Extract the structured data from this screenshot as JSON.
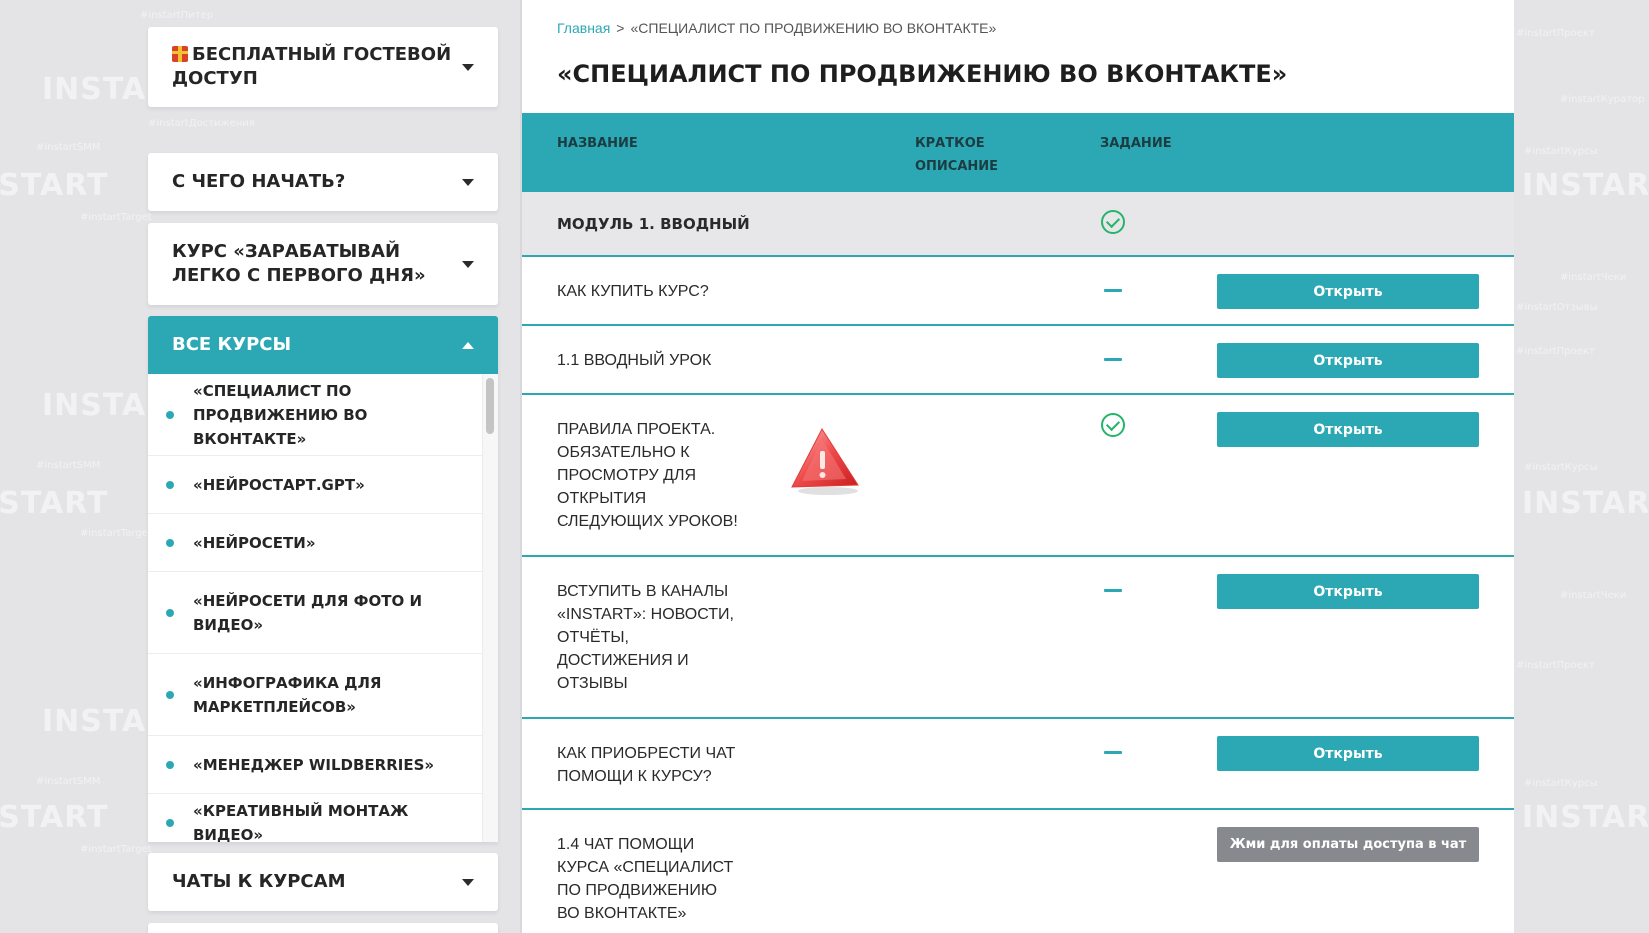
{
  "sidebar": {
    "guest_access": "БЕСПЛАТНЫЙ ГОСТЕВОЙ ДОСТУП",
    "where_to_start": "С ЧЕГО НАЧАТЬ?",
    "easy_course": "КУРС «ЗАРАБАТЫВАЙ ЛЕГКО С ПЕРВОГО ДНЯ»",
    "all_courses": "ВСЕ КУРСЫ",
    "course_chats": "ЧАТЫ К КУРСАМ",
    "courses": [
      "«СПЕЦИАЛИСТ ПО ПРОДВИЖЕНИЮ ВО ВКОНТАКТЕ»",
      "«НЕЙРОСТАРТ.GPT»",
      "«НЕЙРОСЕТИ»",
      "«НЕЙРОСЕТИ ДЛЯ ФОТО И ВИДЕО»",
      "«ИНФОГРАФИКА ДЛЯ МАРКЕТПЛЕЙСОВ»",
      "«МЕНЕДЖЕР WILDBERRIES»",
      "«КРЕАТИВНЫЙ МОНТАЖ ВИДЕО»"
    ]
  },
  "breadcrumb": {
    "home": "Главная",
    "separator": ">",
    "current": "«СПЕЦИАЛИСТ ПО ПРОДВИЖЕНИЮ ВО ВКОНТАКТЕ»"
  },
  "page_title": "«СПЕЦИАЛИСТ ПО ПРОДВИЖЕНИЮ ВО ВКОНТАКТЕ»",
  "table": {
    "headers": {
      "name": "НАЗВАНИЕ",
      "short_desc_1": "КРАТКОЕ",
      "short_desc_2": "ОПИСАНИЕ",
      "task": "ЗАДАНИЕ"
    },
    "module_1": "МОДУЛЬ 1. ВВОДНЫЙ",
    "rows": [
      {
        "title": "КАК КУПИТЬ КУРС?",
        "task": "dash",
        "button": "Открыть"
      },
      {
        "title": "1.1 ВВОДНЫЙ УРОК",
        "task": "dash",
        "button": "Открыть"
      },
      {
        "title_lines": [
          "ПРАВИЛА ПРОЕКТА.",
          "ОБЯЗАТЕЛЬНО К",
          "ПРОСМОТРУ ДЛЯ",
          "ОТКРЫТИЯ",
          "СЛЕДУЮЩИХ УРОКОВ!"
        ],
        "task": "check",
        "icon": "warning-icon",
        "button": "Открыть"
      },
      {
        "title_lines": [
          "ВСТУПИТЬ В КАНАЛЫ",
          "«INSTART»: НОВОСТИ,",
          "ОТЧЁТЫ,",
          "ДОСТИЖЕНИЯ И",
          "ОТЗЫВЫ"
        ],
        "task": "dash",
        "button": "Открыть"
      },
      {
        "title_lines": [
          "КАК ПРИОБРЕСТИ ЧАТ",
          "ПОМОЩИ К КУРСУ?"
        ],
        "task": "dash",
        "button": "Открыть"
      },
      {
        "title_lines": [
          "1.4 ЧАТ ПОМОЩИ",
          "КУРСА «СПЕЦИАЛИСТ",
          "ПО ПРОДВИЖЕНИЮ",
          "ВО ВКОНТАКТЕ»"
        ],
        "task": "none",
        "button": "Жми для оплаты доступа в чат"
      }
    ]
  },
  "background_watermarks": {
    "brand": "INSTART",
    "tags": [
      "#instartПитер",
      "#instartSMM",
      "#instartTarget",
      "#instartДостижения",
      "#instartКурсы",
      "#instartЧеки",
      "#instartПроект",
      "#instartОтзывы",
      "#instartКуратор"
    ]
  },
  "colors": {
    "accent": "#2ca8b5",
    "check": "#24b56a",
    "pay_button": "#868a8e",
    "page_bg": "#e4e4e7"
  }
}
